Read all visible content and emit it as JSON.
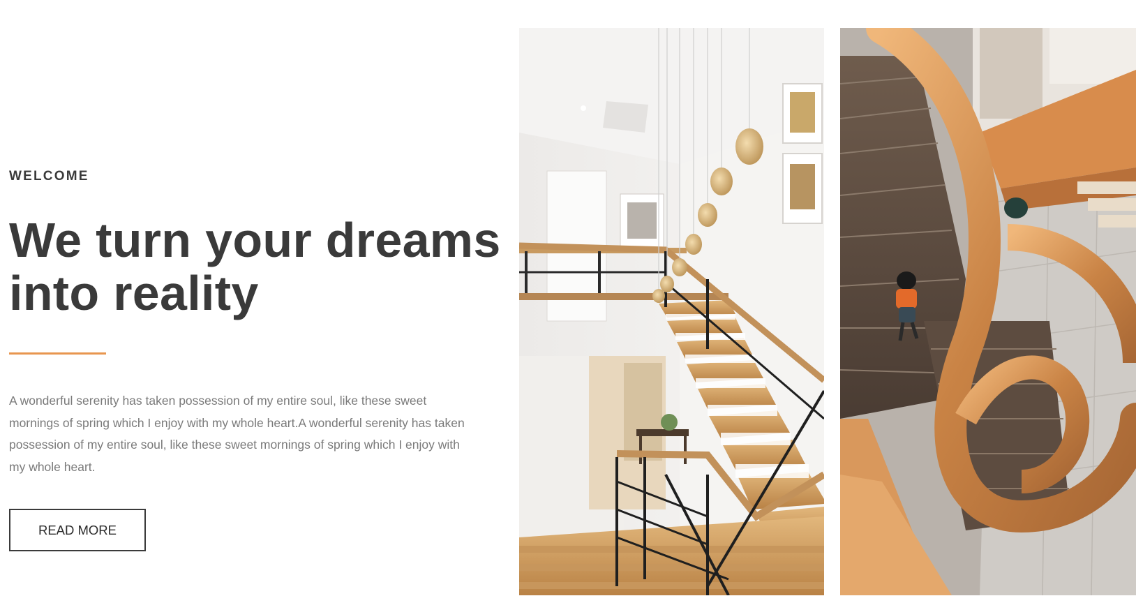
{
  "hero": {
    "eyebrow": "WELCOME",
    "headline_lines": [
      "We turn your dreams",
      "into reality"
    ],
    "body_lines": [
      "A wonderful serenity has taken possession of my entire soul, like these sweet",
      "mornings of spring which I enjoy with my whole heart.A wonderful serenity has taken",
      "possession of my entire soul, like these sweet mornings of spring which I enjoy with",
      "my whole heart."
    ],
    "button_label": "READ MORE"
  },
  "colors": {
    "heading": "#3a3a3a",
    "body": "#7a7a7a",
    "accent": "#e8964f"
  },
  "images": {
    "left": "staircase-interior-photo",
    "right": "spiral-wooden-staircase-photo"
  }
}
